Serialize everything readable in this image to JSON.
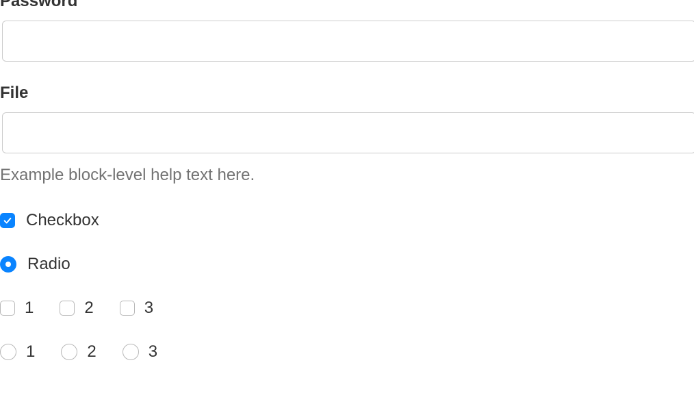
{
  "password": {
    "label": "Password",
    "value": ""
  },
  "file": {
    "label": "File",
    "value": "",
    "help_text": "Example block-level help text here."
  },
  "checkbox": {
    "label": "Checkbox",
    "checked": true
  },
  "radio": {
    "label": "Radio",
    "selected": true
  },
  "inline_checkboxes": [
    {
      "label": "1",
      "checked": false
    },
    {
      "label": "2",
      "checked": false
    },
    {
      "label": "3",
      "checked": false
    }
  ],
  "inline_radios": [
    {
      "label": "1",
      "selected": false
    },
    {
      "label": "2",
      "selected": false
    },
    {
      "label": "3",
      "selected": false
    }
  ]
}
